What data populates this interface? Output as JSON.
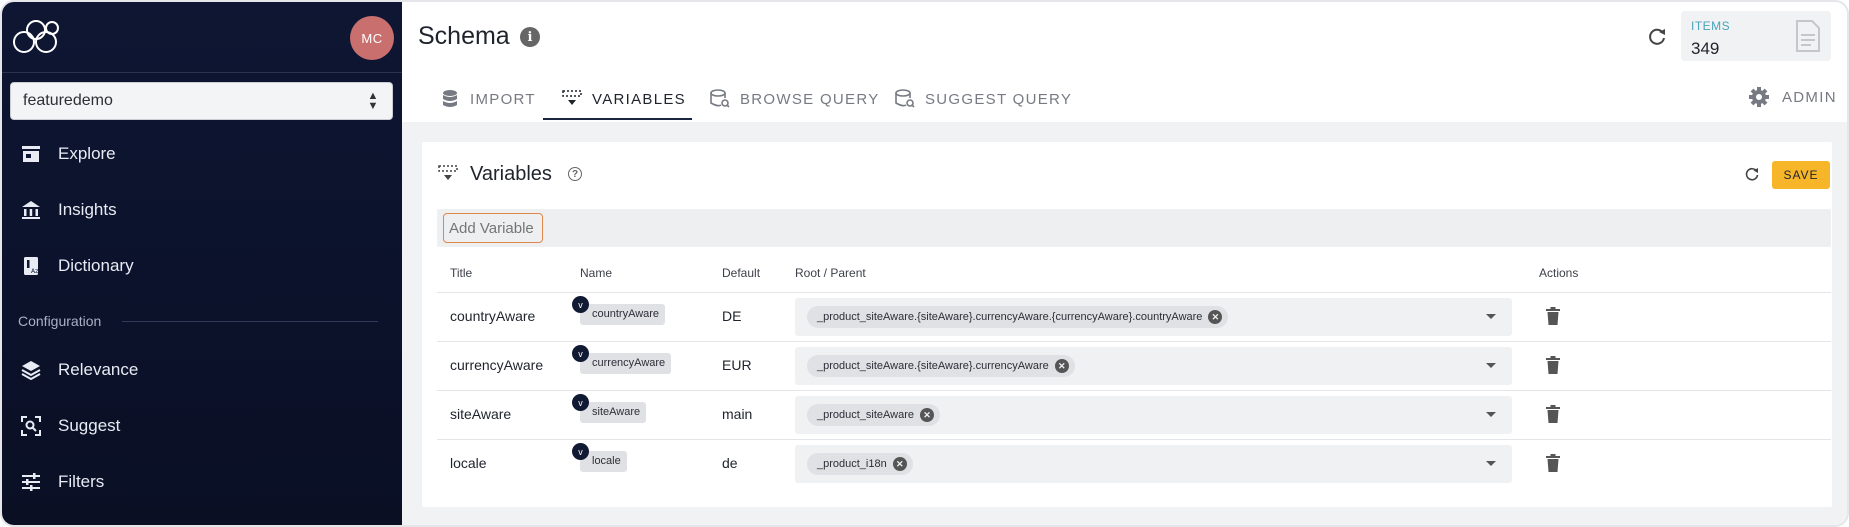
{
  "sidebar": {
    "avatar_initials": "MC",
    "tenant": "featuredemo",
    "nav": [
      {
        "label": "Explore",
        "icon": "storefront-icon"
      },
      {
        "label": "Insights",
        "icon": "bank-icon"
      },
      {
        "label": "Dictionary",
        "icon": "dictionary-icon"
      }
    ],
    "section_label": "Configuration",
    "config_nav": [
      {
        "label": "Relevance",
        "icon": "layers-icon"
      },
      {
        "label": "Suggest",
        "icon": "search-scan-icon"
      },
      {
        "label": "Filters",
        "icon": "sliders-icon"
      }
    ]
  },
  "header": {
    "title": "Schema",
    "items_label": "ITEMS",
    "items_value": "349",
    "tabs": [
      {
        "label": "IMPORT",
        "icon": "database-icon"
      },
      {
        "label": "VARIABLES",
        "icon": "variables-icon"
      },
      {
        "label": "BROWSE QUERY",
        "icon": "database-search-icon"
      },
      {
        "label": "SUGGEST QUERY",
        "icon": "database-search-icon"
      }
    ],
    "active_tab": "VARIABLES",
    "admin_label": "ADMIN"
  },
  "card": {
    "title": "Variables",
    "save_label": "SAVE",
    "add_placeholder": "Add Variable",
    "columns": {
      "title": "Title",
      "name": "Name",
      "default": "Default",
      "root": "Root / Parent",
      "actions": "Actions"
    },
    "badge": "v",
    "rows": [
      {
        "title": "countryAware",
        "name": "countryAware",
        "default": "DE",
        "root": "_product_siteAware.{siteAware}.currencyAware.{currencyAware}.countryAware"
      },
      {
        "title": "currencyAware",
        "name": "currencyAware",
        "default": "EUR",
        "root": "_product_siteAware.{siteAware}.currencyAware"
      },
      {
        "title": "siteAware",
        "name": "siteAware",
        "default": "main",
        "root": "_product_siteAware"
      },
      {
        "title": "locale",
        "name": "locale",
        "default": "de",
        "root": "_product_i18n"
      }
    ]
  },
  "colors": {
    "sidebar_bg": "#0e1633",
    "accent": "#f7b52a",
    "focus": "#e0864a",
    "avatar": "#c9706f"
  }
}
